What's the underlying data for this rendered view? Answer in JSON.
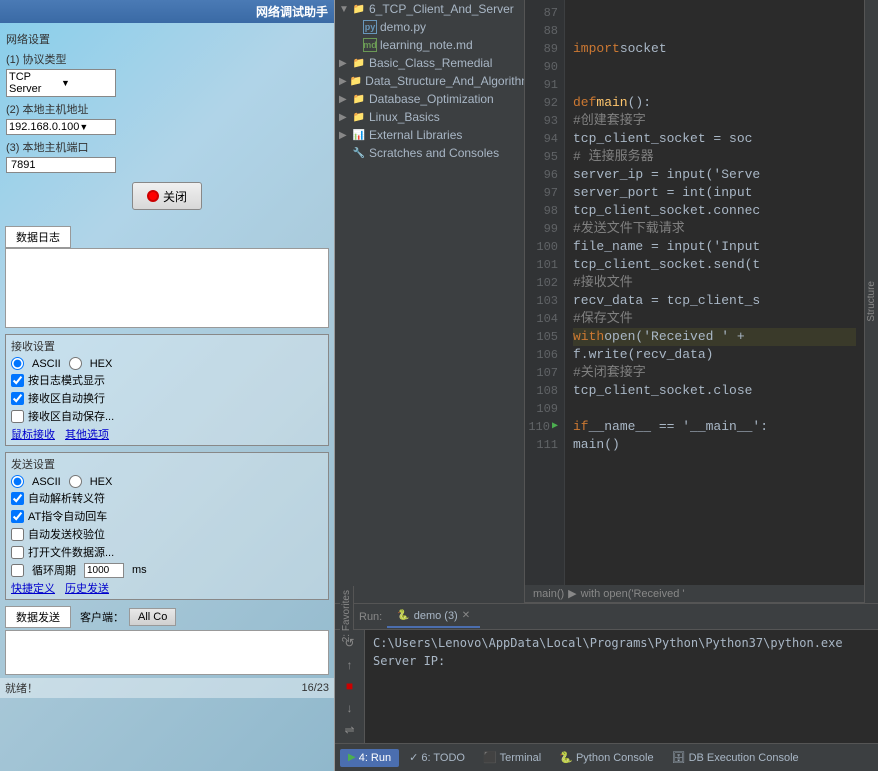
{
  "leftPanel": {
    "title": "网络调试助手",
    "sections": {
      "netSettings": "网络设置",
      "protocol": "(1) 协议类型",
      "protocolValue": "TCP Server",
      "localAddr": "(2) 本地主机地址",
      "localAddrValue": "192.168.0.100",
      "localPort": "(3) 本地主机端口",
      "localPortValue": "7891",
      "closeBtn": "关闭"
    },
    "receive": {
      "title": "接收设置",
      "ascii": "ASCII",
      "hex": "HEX",
      "logMode": "按日志模式显示",
      "autoWrap": "接收区自动换行",
      "autoSave": "接收区自动保存...",
      "shortcuts": "鼠标接收",
      "otherOptions": "其他选项"
    },
    "send": {
      "title": "发送设置",
      "ascii": "ASCII",
      "hex": "HEX",
      "autoEscape": "自动解析转义符",
      "atAutoReturn": "AT指令自动回车",
      "autoCheck": "自动发送校验位",
      "openFile": "打开文件数据源...",
      "cycle": "循环周期",
      "cycleValue": "1000",
      "unit": "ms",
      "quickDef": "快捷定义",
      "histSend": "历史发送"
    },
    "dataLog": "数据日志",
    "dataSend": "数据发送",
    "client": "客户端：",
    "allCo": "All Co",
    "status": "就绪！",
    "counter": "16/23"
  },
  "projectTree": {
    "items": [
      {
        "indent": 0,
        "type": "folder",
        "arrow": "▼",
        "label": "6_TCP_Client_And_Server",
        "selected": false
      },
      {
        "indent": 1,
        "type": "py",
        "label": "demo.py",
        "selected": false
      },
      {
        "indent": 1,
        "type": "md",
        "label": "learning_note.md",
        "selected": false
      },
      {
        "indent": 0,
        "type": "folder-closed",
        "arrow": "▶",
        "label": "Basic_Class_Remedial",
        "selected": false
      },
      {
        "indent": 0,
        "type": "folder-closed",
        "arrow": "▶",
        "label": "Data_Structure_And_Algorithm",
        "selected": false
      },
      {
        "indent": 0,
        "type": "folder-closed",
        "arrow": "▶",
        "label": "Database_Optimization",
        "selected": false
      },
      {
        "indent": 0,
        "type": "folder-closed",
        "arrow": "▶",
        "label": "Linux_Basics",
        "selected": false
      },
      {
        "indent": 0,
        "type": "lib",
        "arrow": "▶",
        "label": "External Libraries",
        "selected": false
      },
      {
        "indent": 0,
        "type": "scratch",
        "arrow": "",
        "label": "Scratches and Consoles",
        "selected": false
      }
    ]
  },
  "codeEditor": {
    "lines": [
      {
        "num": "87",
        "code": "",
        "highlight": false
      },
      {
        "num": "88",
        "code": "",
        "highlight": false
      },
      {
        "num": "89",
        "code": "    import socket",
        "highlight": false
      },
      {
        "num": "90",
        "code": "",
        "highlight": false
      },
      {
        "num": "91",
        "code": "",
        "highlight": false
      },
      {
        "num": "92",
        "code": "def main():",
        "highlight": false
      },
      {
        "num": "93",
        "code": "    #创建套接字",
        "highlight": false
      },
      {
        "num": "94",
        "code": "    tcp_client_socket = soc",
        "highlight": false
      },
      {
        "num": "95",
        "code": "    # 连接服务器",
        "highlight": false
      },
      {
        "num": "96",
        "code": "    server_ip = input('Serve",
        "highlight": false
      },
      {
        "num": "97",
        "code": "    server_port = int(input",
        "highlight": false
      },
      {
        "num": "98",
        "code": "    tcp_client_socket.connec",
        "highlight": false
      },
      {
        "num": "99",
        "code": "    #发送文件下载请求",
        "highlight": false
      },
      {
        "num": "100",
        "code": "    file_name = input('Input",
        "highlight": false
      },
      {
        "num": "101",
        "code": "    tcp_client_socket.send(t",
        "highlight": false
      },
      {
        "num": "102",
        "code": "    #接收文件",
        "highlight": false
      },
      {
        "num": "103",
        "code": "    recv_data = tcp_client_s",
        "highlight": false
      },
      {
        "num": "104",
        "code": "    #保存文件",
        "highlight": false
      },
      {
        "num": "105",
        "code": "    with open('Received ' +",
        "highlight": true
      },
      {
        "num": "106",
        "code": "        f.write(recv_data)",
        "highlight": false
      },
      {
        "num": "107",
        "code": "    #关闭套接字",
        "highlight": false
      },
      {
        "num": "108",
        "code": "    tcp_client_socket.close",
        "highlight": false
      },
      {
        "num": "109",
        "code": "",
        "highlight": false
      },
      {
        "num": "110",
        "code": "if __name__ == '__main__':",
        "highlight": false
      },
      {
        "num": "111",
        "code": "    main()",
        "highlight": false
      }
    ]
  },
  "breadcrumb": {
    "items": [
      "main()",
      "▶",
      "with open('Received '"
    ]
  },
  "runPanel": {
    "tabLabel": "Run:",
    "fileName": "demo (3)",
    "closeSymbol": "✕",
    "output": [
      "C:\\Users\\Lenovo\\AppData\\Local\\Programs\\Python\\Python37\\python.exe",
      "Server IP:"
    ]
  },
  "bottomToolbar": {
    "run": "4: Run",
    "todo": "6: TODO",
    "terminal": "Terminal",
    "pythonConsole": "Python Console",
    "dbExecution": "DB Execution Console"
  },
  "structure": {
    "label": "Structure"
  },
  "favorites": {
    "label": "2: Favorites"
  }
}
